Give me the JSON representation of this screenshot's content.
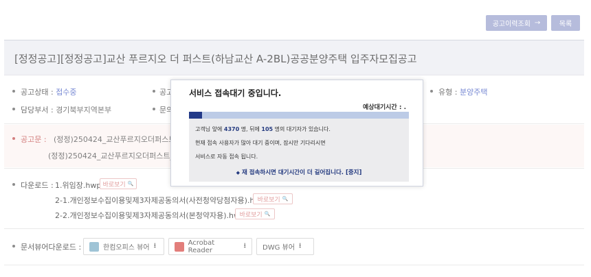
{
  "header": {
    "history_button": "공고이력조회",
    "history_arrow": "→",
    "list_button": "목록"
  },
  "title": "[정정공고][정정공고]교산 푸르지오 더 퍼스트(하남교산 A-2BL)공공분양주택 입주자모집공고",
  "info": {
    "status_label": "공고상태 :",
    "status_value": "접수중",
    "col2_label_partial": "공고",
    "type_label": "유형 :",
    "type_value": "분양주택",
    "dept_label": "담당부서 :",
    "dept_value": "경기북부지역본부",
    "col2_label2_partial": "문의"
  },
  "notice": {
    "label": "공고문 :",
    "line1": "(정정)250424_교산푸르지오더퍼스트_입",
    "line2": "(정정)250424_교산푸르지오더퍼스트_입"
  },
  "downloads": {
    "label": "다운로드 :",
    "files": [
      "1.위임장.hwp",
      "2-1.개인정보수집이용및제3자제공동의서(사전청약당첨자용).hwp",
      "2-2.개인정보수집이용및제3자제공동의서(본청약자용).hwp"
    ],
    "view_label": "바로보기",
    "view_icon": "🔍"
  },
  "viewers": {
    "label": "문서뷰어다운로드 :",
    "items": [
      "한컴오피스 뷰어",
      "Acrobat Reader",
      "DWG 뷰어"
    ],
    "download_icon": "⭳"
  },
  "bottom_partial": "",
  "modal": {
    "title": "서비스 접속대기 중입니다.",
    "wait_label": "예상대기시간 : .",
    "progress": 0.06,
    "queue_pre": "고객님 앞에 ",
    "queue_ahead": "4370",
    "queue_mid": " 명, 뒤에 ",
    "queue_behind": "105",
    "queue_post": " 명의 대기자가 있습니다.",
    "msg1": "현재 접속 사용자가 많아 대기 중이며, 잠시만 기다리시면",
    "msg2": "서비스로 자동 접속 됩니다.",
    "cta": "재 접속하시면 대기시간이 더 길어집니다. [중지]",
    "cta_bullet": "◆"
  },
  "colors": {
    "accent_button": "#9ea6d0",
    "status_blue": "#4b63c5",
    "notice_red": "#c45454",
    "modal_navy": "#23397f"
  }
}
